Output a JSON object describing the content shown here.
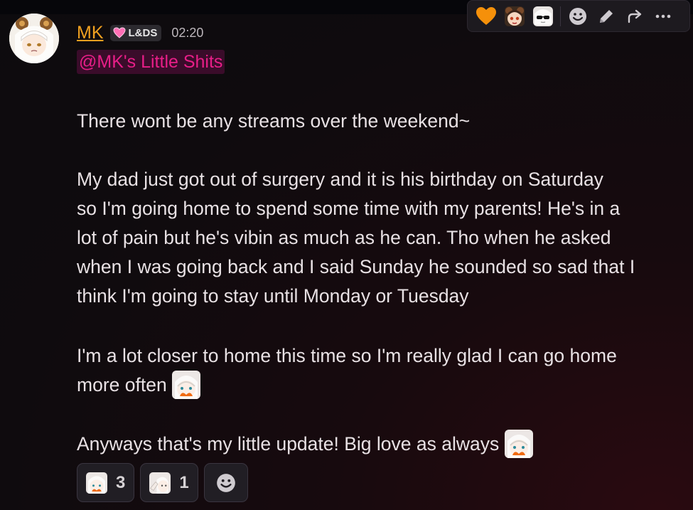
{
  "message": {
    "username": "MK",
    "tag": "L&DS",
    "time": "02:20",
    "mention": "@MK's Little Shits",
    "paragraphs": {
      "p1": "There wont be any streams over the weekend~",
      "p2_l1": "My dad just got out of surgery and it is his birthday on Saturday",
      "p2_l2": "so I'm going home to spend some time with my parents! He's in a",
      "p2_l3": "lot of pain but he's vibin as much as he can. Tho when he asked",
      "p2_l4": "when I was going back and I said Sunday he sounded so sad that I",
      "p2_l5": "think I'm going to stay until Monday or Tuesday",
      "p3_l1": "I'm a lot closer to home this time so I'm really glad I can go home",
      "p3_l2": "more often",
      "p4": "Anyways that's my little update! Big love as always"
    }
  },
  "reactions": [
    {
      "emoji": "crying-heart-emoji",
      "count": "3"
    },
    {
      "emoji": "wave-emoji",
      "count": "1"
    }
  ],
  "toolbar": {
    "items": [
      "orange-heart-icon",
      "bun-girl-emoji",
      "sunglasses-emoji",
      "add-reaction-icon",
      "edit-icon",
      "forward-icon",
      "more-icon"
    ]
  },
  "colors": {
    "username": "#f0a020",
    "mention_text": "#e81e88",
    "mention_bg": "#3a0c2a",
    "tag_heart": "#ff6fb5"
  }
}
